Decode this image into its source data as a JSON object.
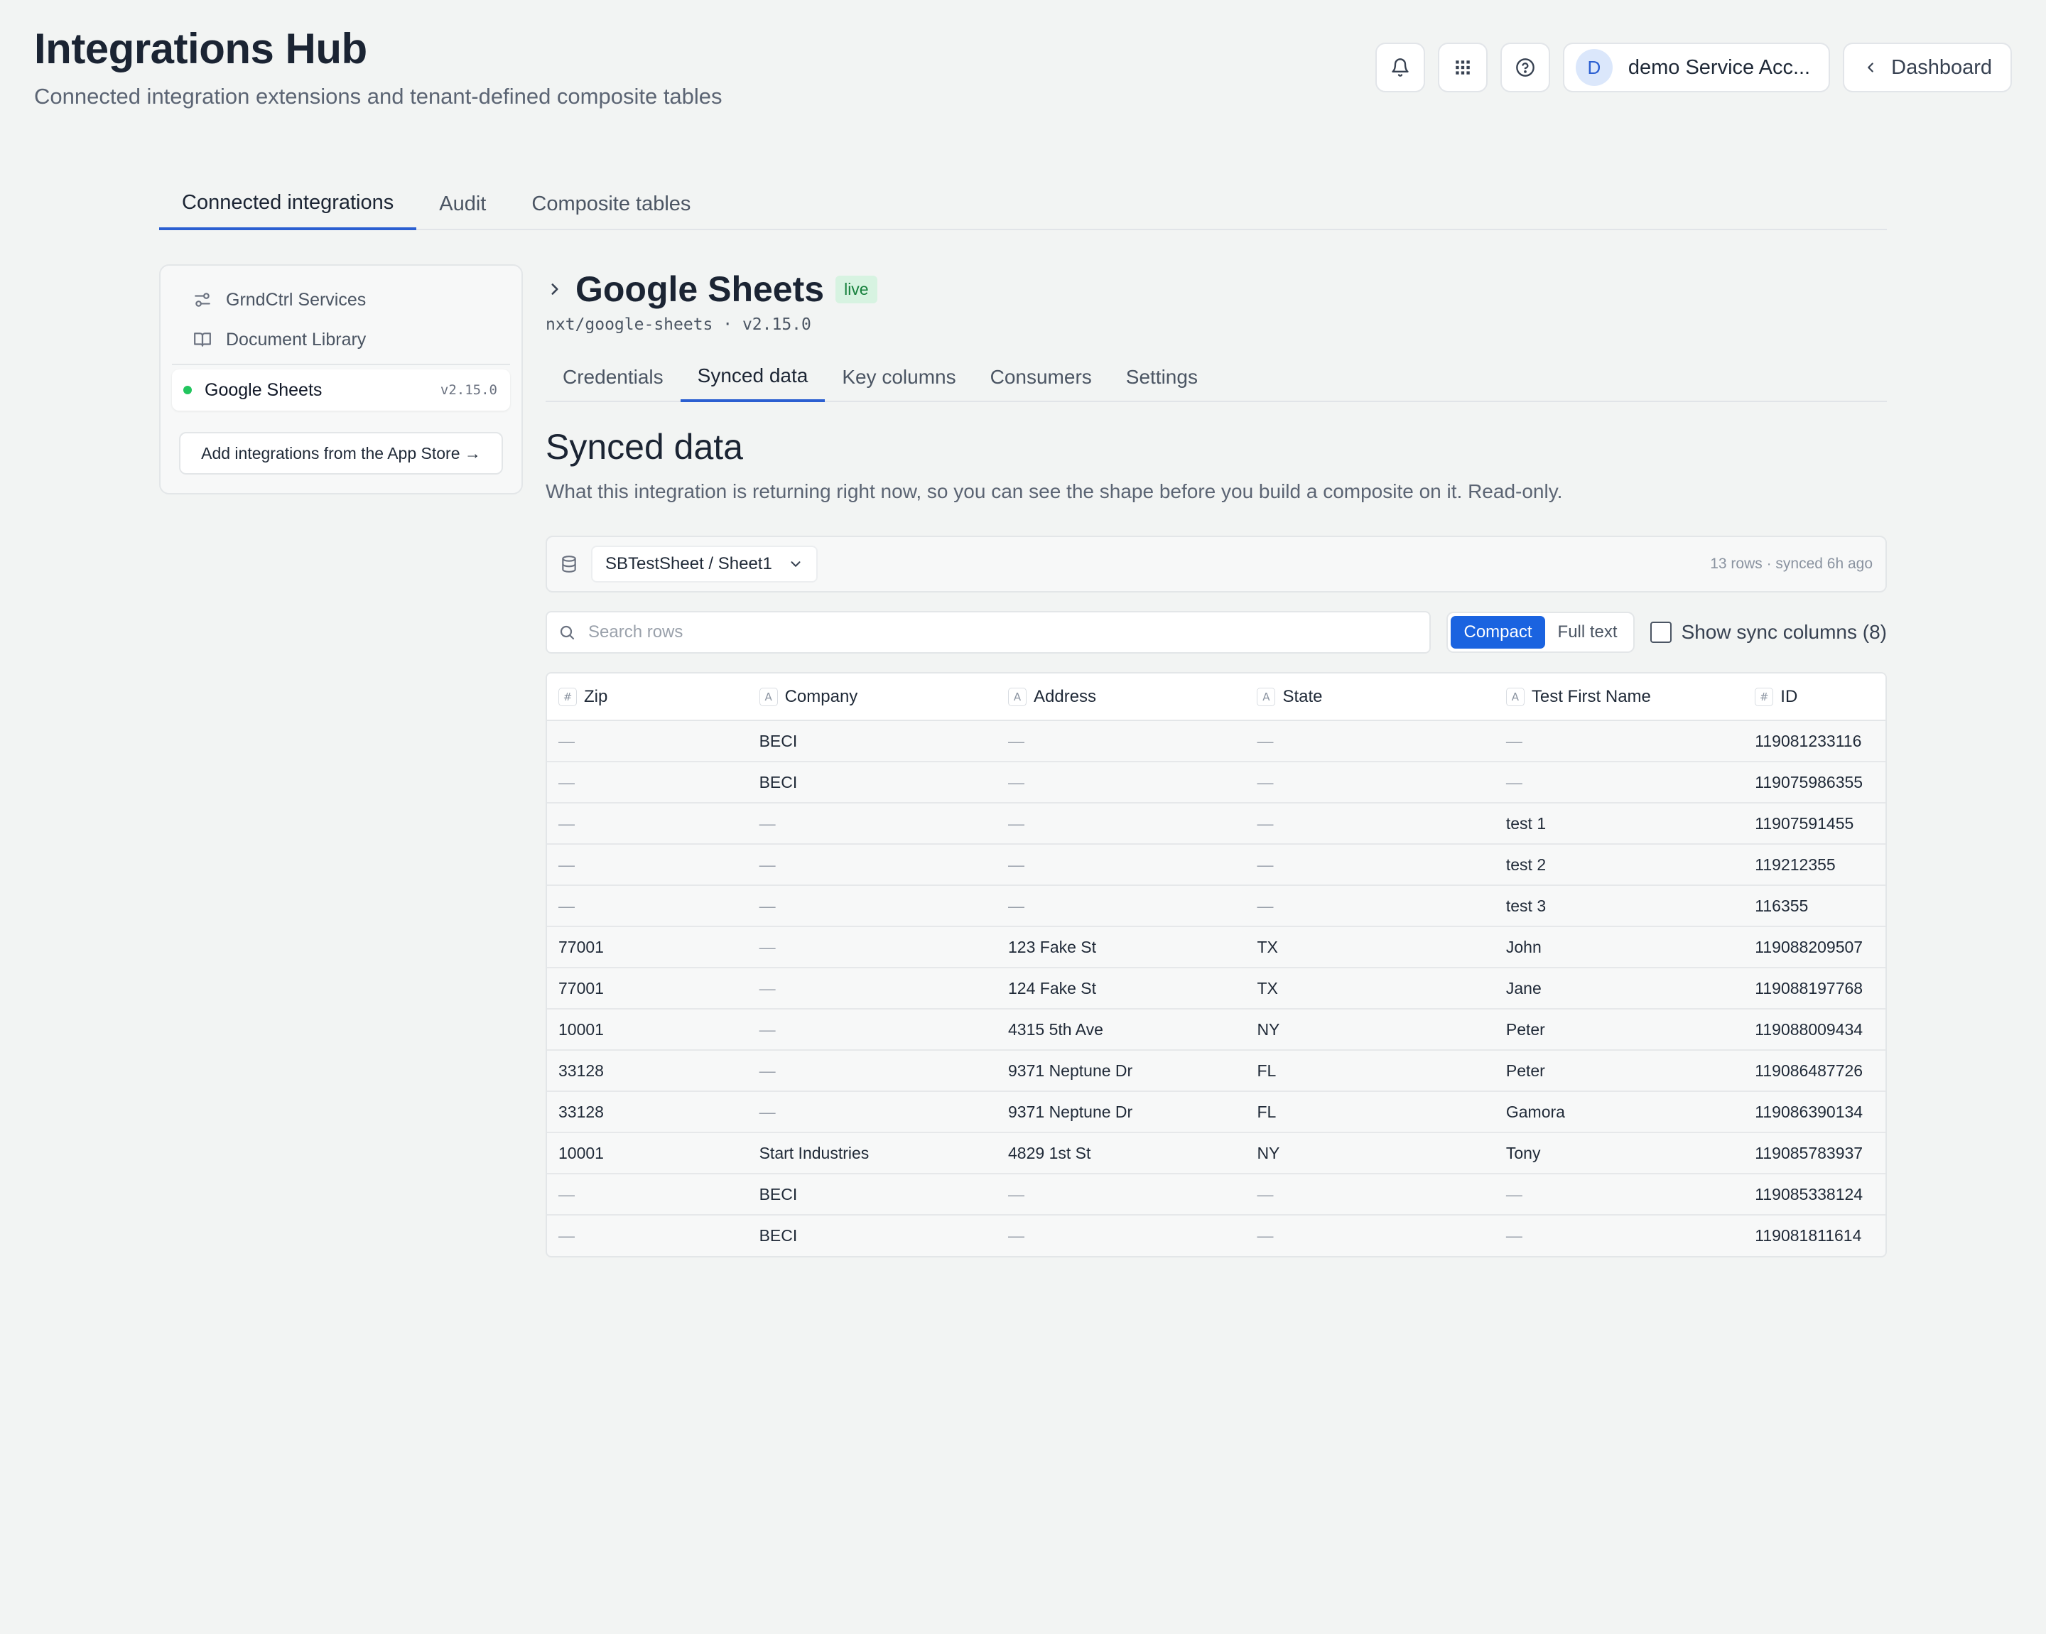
{
  "header": {
    "title": "Integrations Hub",
    "subtitle": "Connected integration extensions and tenant-defined composite tables",
    "account_initial": "D",
    "account_name": "demo Service Acc...",
    "dashboard_label": "Dashboard"
  },
  "main_tabs": [
    {
      "label": "Connected integrations"
    },
    {
      "label": "Audit"
    },
    {
      "label": "Composite tables"
    }
  ],
  "sidebar": {
    "items": [
      {
        "label": "GrndCtrl Services",
        "icon": "sliders-icon"
      },
      {
        "label": "Document Library",
        "icon": "book-icon"
      }
    ],
    "active": {
      "label": "Google Sheets",
      "version": "v2.15.0"
    },
    "add_label": "Add integrations from the App Store →"
  },
  "integration": {
    "title": "Google Sheets",
    "badge": "live",
    "path": "nxt/google-sheets · v2.15.0",
    "tabs": [
      {
        "label": "Credentials"
      },
      {
        "label": "Synced data"
      },
      {
        "label": "Key columns"
      },
      {
        "label": "Consumers"
      },
      {
        "label": "Settings"
      }
    ]
  },
  "synced": {
    "title": "Synced data",
    "description": "What this integration is returning right now, so you can see the shape before you build a composite on it. Read-only.",
    "source": "SBTestSheet / Sheet1",
    "meta": "13 rows · synced 6h ago",
    "search_placeholder": "Search rows",
    "view_compact": "Compact",
    "view_full": "Full text",
    "show_sync_label": "Show sync columns (8)"
  },
  "table": {
    "columns": [
      {
        "type": "#",
        "label": "Zip"
      },
      {
        "type": "A",
        "label": "Company"
      },
      {
        "type": "A",
        "label": "Address"
      },
      {
        "type": "A",
        "label": "State"
      },
      {
        "type": "A",
        "label": "Test First Name"
      },
      {
        "type": "#",
        "label": "ID"
      }
    ],
    "rows": [
      [
        "—",
        "BECI",
        "—",
        "—",
        "—",
        "119081233116"
      ],
      [
        "—",
        "BECI",
        "—",
        "—",
        "—",
        "119075986355"
      ],
      [
        "—",
        "—",
        "—",
        "—",
        "test 1",
        "11907591455"
      ],
      [
        "—",
        "—",
        "—",
        "—",
        "test 2",
        "119212355"
      ],
      [
        "—",
        "—",
        "—",
        "—",
        "test 3",
        "116355"
      ],
      [
        "77001",
        "—",
        "123 Fake St",
        "TX",
        "John",
        "119088209507"
      ],
      [
        "77001",
        "—",
        "124 Fake St",
        "TX",
        "Jane",
        "119088197768"
      ],
      [
        "10001",
        "—",
        "4315 5th Ave",
        "NY",
        "Peter",
        "119088009434"
      ],
      [
        "33128",
        "—",
        "9371 Neptune Dr",
        "FL",
        "Peter",
        "119086487726"
      ],
      [
        "33128",
        "—",
        "9371 Neptune Dr",
        "FL",
        "Gamora",
        "119086390134"
      ],
      [
        "10001",
        "Start Industries",
        "4829 1st St",
        "NY",
        "Tony",
        "119085783937"
      ],
      [
        "—",
        "BECI",
        "—",
        "—",
        "—",
        "119085338124"
      ],
      [
        "—",
        "BECI",
        "—",
        "—",
        "—",
        "119081811614"
      ]
    ]
  }
}
